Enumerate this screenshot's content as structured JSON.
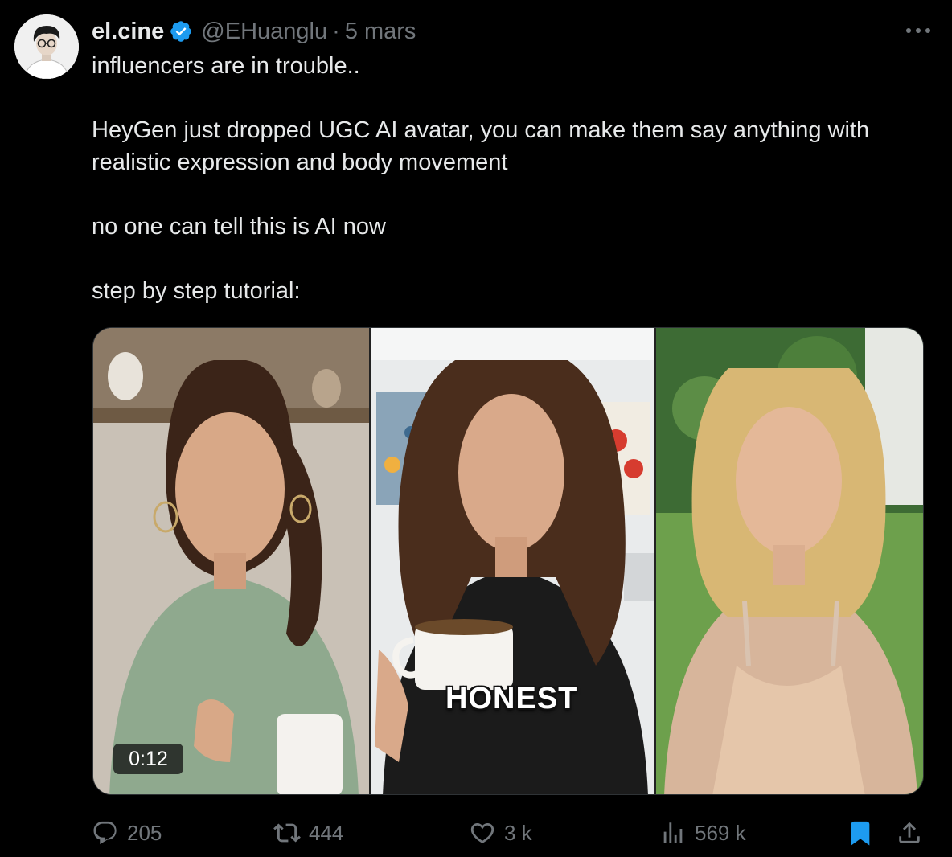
{
  "tweet": {
    "author": {
      "display_name": "el.cine",
      "verified": true,
      "handle": "@EHuanglu",
      "separator": "·",
      "date": "5 mars"
    },
    "text": [
      "influencers are in trouble..",
      "HeyGen just dropped UGC AI avatar, you can make them say anything with realistic expression and body movement",
      "no one can tell this is AI now",
      "step by step tutorial:"
    ],
    "media": {
      "type": "video",
      "caption_overlay": "HONEST",
      "duration": "0:12"
    },
    "actions": {
      "replies": "205",
      "reposts": "444",
      "likes": "3 k",
      "views": "569 k"
    }
  },
  "colors": {
    "background": "#000000",
    "text_primary": "#e7e9ea",
    "text_secondary": "#71767b",
    "accent": "#1d9bf0",
    "border": "#2f3336"
  },
  "icons": {
    "verified": "verified-badge-icon",
    "more": "more-horizontal-icon",
    "reply": "reply-icon",
    "repost": "repost-icon",
    "like": "heart-icon",
    "views": "views-icon",
    "bookmark": "bookmark-icon",
    "share": "share-icon"
  }
}
